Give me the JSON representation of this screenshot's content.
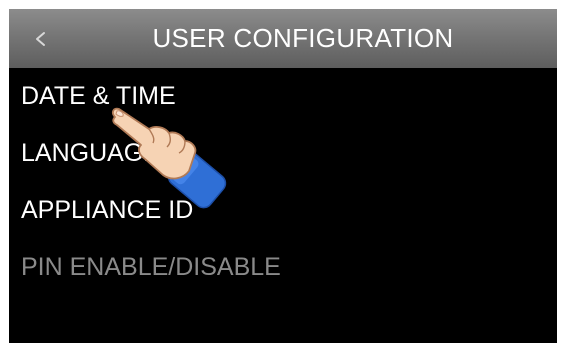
{
  "header": {
    "title": "USER CONFIGURATION",
    "back_icon": "chevron-left-icon"
  },
  "menu": {
    "items": [
      {
        "label": "DATE & TIME",
        "enabled": true
      },
      {
        "label": "LANGUAGE",
        "enabled": true
      },
      {
        "label": "APPLIANCE ID",
        "enabled": true
      },
      {
        "label": "PIN ENABLE/DISABLE",
        "enabled": false
      }
    ]
  },
  "overlay": {
    "icon": "pointing-hand-icon"
  },
  "colors": {
    "background": "#000000",
    "header_gradient_top": "#8c8c8c",
    "header_gradient_bottom": "#5e5e5e",
    "text": "#ffffff",
    "disabled_text": "#8a8a8a",
    "cuff_blue": "#2f6fd6"
  }
}
